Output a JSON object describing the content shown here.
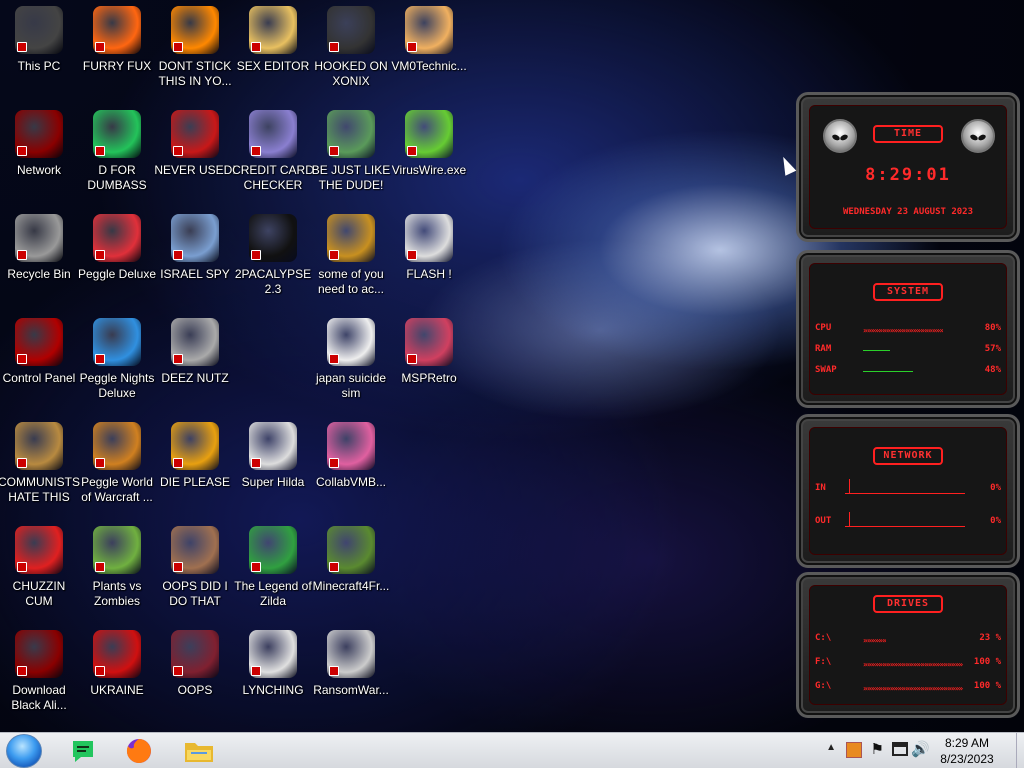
{
  "desktop": {
    "icons": [
      {
        "label": "This PC",
        "icon": "this-pc-icon",
        "color": "#444"
      },
      {
        "label": "FURRY FUX",
        "icon": "firefox-icon",
        "color": "#ff6611"
      },
      {
        "label": "DONT STICK THIS IN YO...",
        "icon": "vlc-cone-icon",
        "color": "#ff8800"
      },
      {
        "label": "SEX EDITOR",
        "icon": "hxd-editor-icon",
        "color": "#e8c060"
      },
      {
        "label": "HOOKED ON XONIX",
        "icon": "xonix-game-icon",
        "color": "#333"
      },
      {
        "label": "VM0Technic...",
        "icon": "technician-person-icon",
        "color": "#f0b060"
      },
      {
        "label": "Network",
        "icon": "alien-network-icon",
        "color": "#8a0000"
      },
      {
        "label": "D FOR DUMBASS",
        "icon": "discord-green-icon",
        "color": "#23c35a"
      },
      {
        "label": "NEVER USED!",
        "icon": "dev-cpp-icon",
        "color": "#c81818"
      },
      {
        "label": "CREDIT CARD CHECKER",
        "icon": "credit-card-icon",
        "color": "#8a7fd0"
      },
      {
        "label": "BE JUST LIKE THE DUDE!",
        "icon": "dude-face-icon",
        "color": "#5a9a5a"
      },
      {
        "label": "VirusWire.exe",
        "icon": "limewire-icon",
        "color": "#66cc33"
      },
      {
        "label": "Recycle Bin",
        "icon": "recycle-bin-icon",
        "color": "#999"
      },
      {
        "label": "Peggle Deluxe",
        "icon": "peggle-icon",
        "color": "#e0303a"
      },
      {
        "label": "ISRAEL SPY",
        "icon": "network-spy-icon",
        "color": "#7a9ed0"
      },
      {
        "label": "2PACALYPSE 2.3",
        "icon": "command-prompt-icon",
        "color": "#111"
      },
      {
        "label": "some of you need to ac...",
        "icon": "beaver-icon",
        "color": "#c89020"
      },
      {
        "label": "FLASH !",
        "icon": "flash-document-icon",
        "color": "#ddd"
      },
      {
        "label": "Control Panel",
        "icon": "control-panel-icon",
        "color": "#b00000"
      },
      {
        "label": "Peggle Nights Deluxe",
        "icon": "peggle-nights-icon",
        "color": "#3090e0"
      },
      {
        "label": "DEEZ NUTZ",
        "icon": "stacked-windows-icon",
        "color": "#aaa"
      },
      {
        "label": "japan suicide sim",
        "icon": "figures-document-icon",
        "color": "#eee"
      },
      {
        "label": "MSPRetro",
        "icon": "msp-retro-icon",
        "color": "#d04060"
      },
      {
        "label": "COMMUNISTS HATE THIS G...",
        "icon": "money-bag-icon",
        "color": "#b88a40"
      },
      {
        "label": "Peggle World of Warcraft ...",
        "icon": "peggle-wow-icon",
        "color": "#d08020"
      },
      {
        "label": "DIE PLEASE",
        "icon": "adobe-de-icon",
        "color": "#e8a010"
      },
      {
        "label": "Super Hilda",
        "icon": "pixel-character-icon",
        "color": "#ddd"
      },
      {
        "label": "CollabVMB...",
        "icon": "collabvm-monitor-icon",
        "color": "#e060a0"
      },
      {
        "label": "CHUZZIN CUM",
        "icon": "chuzzle-icon",
        "color": "#e02020"
      },
      {
        "label": "Plants vs Zombies",
        "icon": "plants-vs-zombies-icon",
        "color": "#70b040"
      },
      {
        "label": "OOPS DID I DO THAT",
        "icon": "portrait-lady-icon",
        "color": "#a07050"
      },
      {
        "label": "The Legend of Zilda",
        "icon": "zelda-sprite-icon",
        "color": "#30a040"
      },
      {
        "label": "Minecraft4Fr...",
        "icon": "minecraft-block-icon",
        "color": "#5a8a30"
      },
      {
        "label": "Download Black Ali...",
        "icon": "alien-download-icon",
        "color": "#8a0000"
      },
      {
        "label": "UKRAINE",
        "icon": "radiation-icon",
        "color": "#d01010"
      },
      {
        "label": "OOPS",
        "icon": "red-app-icon",
        "color": "#802030"
      },
      {
        "label": "LYNCHING",
        "icon": "noose-bell-icon",
        "color": "#e0e0e0"
      },
      {
        "label": "RansomWar...",
        "icon": "skull-icon",
        "color": "#ccc"
      }
    ]
  },
  "widgets": {
    "time": {
      "title": "TIME",
      "clock": "8:29:01",
      "date": "WEDNESDAY 23 AUGUST 2023"
    },
    "system": {
      "title": "SYSTEM",
      "rows": [
        {
          "name": "CPU",
          "value": "80%",
          "level": 0.8,
          "line": "red"
        },
        {
          "name": "RAM",
          "value": "57%",
          "level": 0.3,
          "line": "green"
        },
        {
          "name": "SWAP",
          "value": "48%",
          "level": 0.55,
          "line": "green"
        }
      ]
    },
    "network": {
      "title": "NETWORK",
      "rows": [
        {
          "name": "IN",
          "value": "0%"
        },
        {
          "name": "OUT",
          "value": "0%"
        }
      ]
    },
    "drives": {
      "title": "DRIVES",
      "rows": [
        {
          "name": "C:\\",
          "value": "23 %",
          "level": 0.23
        },
        {
          "name": "F:\\",
          "value": "100 %",
          "level": 1.0
        },
        {
          "name": "G:\\",
          "value": "100 %",
          "level": 1.0
        }
      ]
    }
  },
  "taskbar": {
    "pinned": [
      {
        "name": "start-orb",
        "icon": "windows-orb-icon"
      },
      {
        "name": "discord",
        "icon": "discord-green-icon"
      },
      {
        "name": "firefox",
        "icon": "firefox-icon"
      },
      {
        "name": "file-explorer",
        "icon": "folder-icon"
      }
    ],
    "tray_icons": [
      "chevron-up-icon",
      "app-tray-icon",
      "flag-icon",
      "network-icon",
      "volume-icon"
    ],
    "time": "8:29 AM",
    "date": "8/23/2023"
  },
  "colors": {
    "accent_red": "#ff2a2a",
    "taskbar": "#e4e6ea"
  }
}
